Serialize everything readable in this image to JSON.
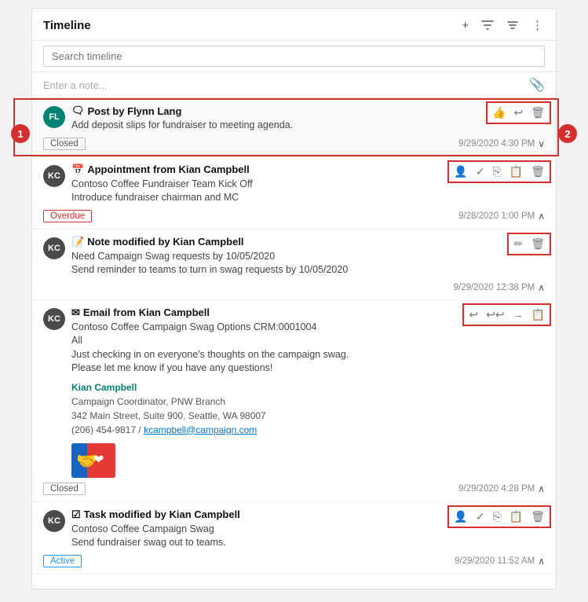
{
  "panel": {
    "title": "Timeline",
    "search_placeholder": "Search timeline",
    "note_placeholder": "Enter a note...",
    "icons": {
      "add": "+",
      "filter": "⊿",
      "sort": "≡",
      "more": "⋮",
      "paperclip": "📎"
    }
  },
  "circles": {
    "c1": "1",
    "c2": "2"
  },
  "items": [
    {
      "id": "post-1",
      "type": "Post",
      "type_icon": "🗨",
      "author": "Flynn Lang",
      "avatar": "FL",
      "avatar_class": "avatar-fl",
      "body1": "Add deposit slips for fundraiser to meeting agenda.",
      "body2": "",
      "badge": "Closed",
      "badge_class": "badge",
      "timestamp": "9/29/2020 4:30 PM",
      "actions": [
        "👍",
        "↩",
        "🗑"
      ],
      "expanded": true
    },
    {
      "id": "appointment-1",
      "type": "Appointment",
      "type_icon": "📅",
      "author": "Kian Campbell",
      "avatar": "KC",
      "avatar_class": "avatar-kc",
      "body1": "Contoso Coffee Fundraiser Team Kick Off",
      "body2": "Introduce fundraiser chairman and MC",
      "badge": "Overdue",
      "badge_class": "badge badge-overdue",
      "timestamp": "9/28/2020 1:00 PM",
      "actions": [
        "👤",
        "✓",
        "⎘",
        "📋",
        "🗑"
      ],
      "expanded": false
    },
    {
      "id": "note-1",
      "type": "Note",
      "type_icon": "📝",
      "author": "Kian Campbell",
      "avatar": "KC",
      "avatar_class": "avatar-kc",
      "body1": "Need Campaign Swag requests by 10/05/2020",
      "body2": "Send reminder to teams to turn in swag requests by 10/05/2020",
      "badge": "",
      "badge_class": "",
      "timestamp": "9/29/2020 12:38 PM",
      "actions": [
        "✏",
        "🗑"
      ],
      "expanded": false
    },
    {
      "id": "email-1",
      "type": "Email",
      "type_icon": "✉",
      "author": "Kian Campbell",
      "avatar": "KC",
      "avatar_class": "avatar-kc",
      "body1": "Contoso Coffee Campaign Swag Options CRM:0001004",
      "body2": "All",
      "body3": "Just checking in on everyone's thoughts on the campaign swag.",
      "body4": "Please let me know if you have any questions!",
      "sig_name": "Kian Campbell",
      "sig_role": "Campaign Coordinator, PNW Branch",
      "sig_address": "342 Main Street, Suite 900, Seattle, WA 98007",
      "sig_phone": "(206) 454-9817 /",
      "sig_email": "kcampbell@campaign.com",
      "badge": "Closed",
      "badge_class": "badge",
      "timestamp": "9/29/2020 4:28 PM",
      "actions": [
        "↩",
        "↩↩",
        "→",
        "📋"
      ],
      "expanded": true
    },
    {
      "id": "task-1",
      "type": "Task",
      "type_icon": "☑",
      "author": "Kian Campbell",
      "avatar": "KC",
      "avatar_class": "avatar-kc",
      "body1": "Contoso Coffee Campaign Swag",
      "body2": "Send fundraiser swag out to teams.",
      "badge": "Active",
      "badge_class": "badge badge-active",
      "timestamp": "9/29/2020 11:52 AM",
      "actions": [
        "👤",
        "✓",
        "⎘",
        "📋",
        "🗑"
      ],
      "expanded": false
    }
  ]
}
